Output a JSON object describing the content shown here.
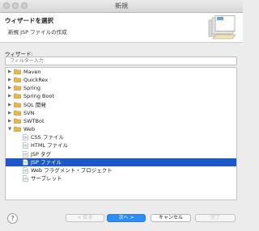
{
  "window": {
    "title": "新規"
  },
  "header": {
    "title": "ウィザードを選択",
    "subtitle": "新規 JSP ファイルの作成"
  },
  "wizard": {
    "label": "ウィザード:",
    "filter_placeholder": "フィルター入力"
  },
  "tree": {
    "items": [
      {
        "label": "Maven",
        "type": "folder",
        "expanded": false
      },
      {
        "label": "QuickRex",
        "type": "folder",
        "expanded": false
      },
      {
        "label": "Spring",
        "type": "folder",
        "expanded": false
      },
      {
        "label": "Spring Boot",
        "type": "folder",
        "expanded": false
      },
      {
        "label": "SQL 開発",
        "type": "folder",
        "expanded": false
      },
      {
        "label": "SVN",
        "type": "folder",
        "expanded": false
      },
      {
        "label": "SWTBot",
        "type": "folder",
        "expanded": false
      },
      {
        "label": "Web",
        "type": "folder",
        "expanded": true
      },
      {
        "label": "CSS ファイル",
        "type": "file"
      },
      {
        "label": "HTML ファイル",
        "type": "file"
      },
      {
        "label": "JSP タグ",
        "type": "file"
      },
      {
        "label": "JSP ファイル",
        "type": "file",
        "selected": true
      },
      {
        "label": "Web フラグメント・プロジェクト",
        "type": "file"
      },
      {
        "label": "サーブレット",
        "type": "file"
      }
    ]
  },
  "footer": {
    "help_icon": "?",
    "back_label": "< 戻る",
    "next_label": "次へ >",
    "cancel_label": "キャンセル",
    "finish_label": "完了"
  },
  "colors": {
    "selection": "#1e57c8",
    "folder": "#e8b84a",
    "primary_button": "#2f8bf5"
  }
}
